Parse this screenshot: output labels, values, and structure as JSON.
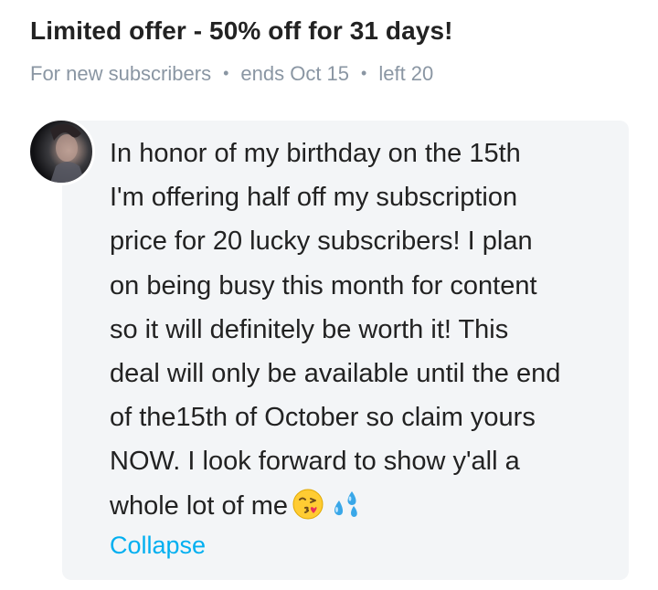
{
  "offer": {
    "title": "Limited offer - 50% off for 31 days!",
    "audience": "For new subscribers",
    "ends": "ends Oct 15",
    "left": "left 20",
    "separator": "•"
  },
  "post": {
    "lines": [
      "In honor of my birthday on the 15th",
      "I'm offering half off my subscription",
      "price for 20 lucky subscribers! I plan",
      "on being busy this month for content",
      "so it will definitely be worth it! This",
      "deal will only be available until the end",
      "of the15th of October so claim yours",
      "NOW. I look forward to show y'all a",
      "whole lot of me"
    ],
    "emojis": [
      "kissing-face-emoji",
      "sweat-droplets-emoji"
    ],
    "collapse_label": "Collapse"
  },
  "colors": {
    "accent": "#00aff0",
    "muted": "#8a96a3",
    "text": "#222222",
    "card_bg": "#f3f5f7"
  }
}
